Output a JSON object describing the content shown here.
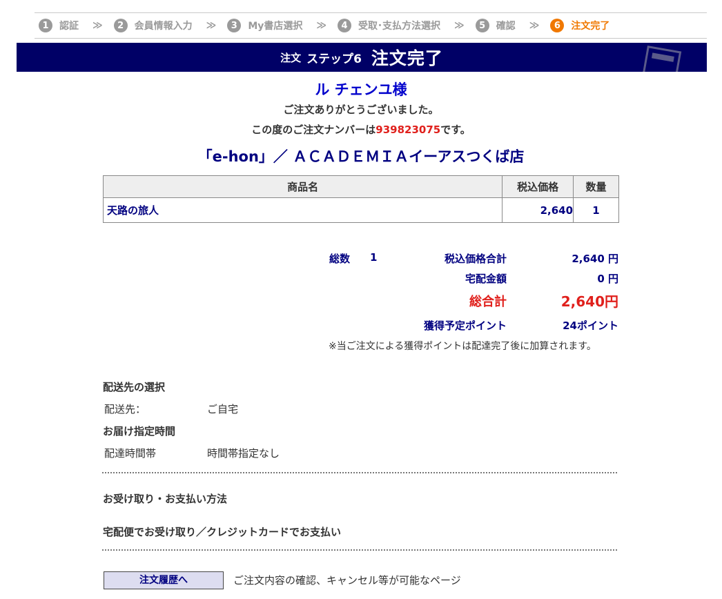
{
  "steps": [
    {
      "num": "1",
      "label": "認証"
    },
    {
      "num": "2",
      "label": "会員情報入力"
    },
    {
      "num": "3",
      "label": "My書店選択"
    },
    {
      "num": "4",
      "label": "受取･支払方法選択"
    },
    {
      "num": "5",
      "label": "確認"
    },
    {
      "num": "6",
      "label": "注文完了"
    }
  ],
  "step_separator": "≫",
  "banner": {
    "prefix": "注文",
    "step": "ステップ6",
    "title": "注文完了"
  },
  "customer_name": "ル チェンユ様",
  "thanks_message": "ご注文ありがとうございました。",
  "order_number": {
    "prefix": "この度のご注文ナンバーは",
    "number": "939823075",
    "suffix": "です。"
  },
  "store_name": "「e-hon」／ ＡＣＡＤＥＭＩＡイーアスつくば店",
  "items_table": {
    "headers": {
      "name": "商品名",
      "price": "税込価格",
      "qty": "数量"
    },
    "rows": [
      {
        "name": "天路の旅人",
        "price": "2,640",
        "qty": "1"
      }
    ]
  },
  "summary": {
    "count_label": "総数",
    "count_value": "1",
    "subtotal_label": "税込価格合計",
    "subtotal_value": "2,640 円",
    "shipping_label": "宅配金額",
    "shipping_value": "0 円",
    "total_label": "総合計",
    "total_value": "2,640円",
    "points_label": "獲得予定ポイント",
    "points_value": "24ポイント",
    "points_note": "※当ご注文による獲得ポイントは配達完了後に加算されます。"
  },
  "delivery": {
    "section_title": "配送先の選択",
    "address_label": "配送先：",
    "address_value": "ご自宅",
    "time_section_title": "お届け指定時間",
    "time_label": "配達時間帯",
    "time_value": "時間帯指定なし"
  },
  "payment": {
    "section_title": "お受け取り・お支払い方法",
    "method": "宅配便でお受け取り／クレジットカードでお支払い"
  },
  "history": {
    "button_label": "注文履歴へ",
    "description": "ご注文内容の確認、キャンセル等が可能なページ"
  },
  "colors": {
    "banner_bg": "#000066",
    "active_step": "#f07800",
    "accent_red": "#e0201c",
    "navy_text": "#000080"
  }
}
